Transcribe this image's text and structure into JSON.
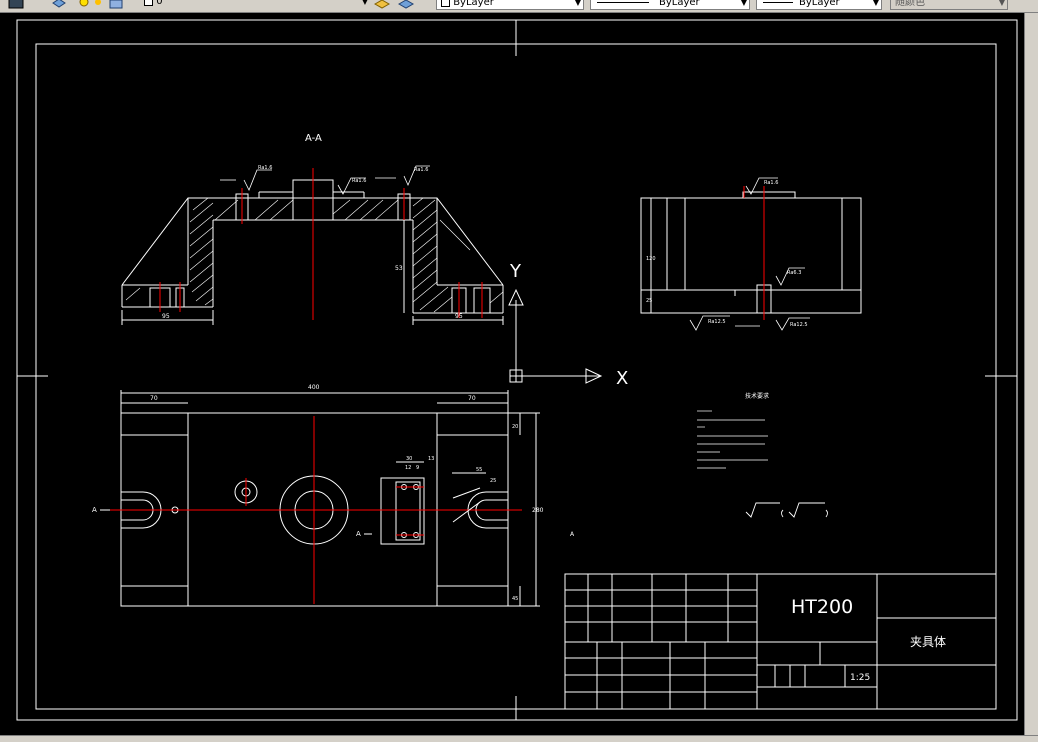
{
  "toolbar": {
    "layer_value": "0",
    "color_value": "ByLayer",
    "linetype_value": "ByLayer",
    "lineweight_value": "ByLayer",
    "plotstyle_value": "随颜色"
  },
  "drawing": {
    "section_label": "A-A",
    "axis_y": "Y",
    "axis_x": "X",
    "material": "HT200",
    "part_name": "夹具体",
    "scale": "1:25",
    "technical_requirements_title": "技术要求",
    "dims": {
      "left_width": "95",
      "right_width": "95",
      "overall_length": "400",
      "left_flange": "70",
      "right_flange": "70",
      "height_a": "53",
      "side_height": "120",
      "side_base": "25",
      "overall_height": "280",
      "top_margin": "20",
      "bottom_margin": "45",
      "spacing_30": "30",
      "spacing_12": "12",
      "spacing_9": "9",
      "spacing_13": "13",
      "spacing_55": "55",
      "spacing_25": "25"
    },
    "labels": {
      "al_left": "A",
      "al_mid": "A",
      "a_right": "A"
    },
    "roughness": {
      "r1": "Ra1.6",
      "r2": "Ra1.6",
      "r3": "Ra1.6",
      "r4": "Ra1.6",
      "r5": "Ra6.3",
      "r6": "Ra12.5",
      "r7": "Ra12.5"
    }
  },
  "colors": {
    "line": "#ffffff",
    "center": "#ff0000",
    "background": "#000000",
    "ui": "#d4d0c8"
  }
}
